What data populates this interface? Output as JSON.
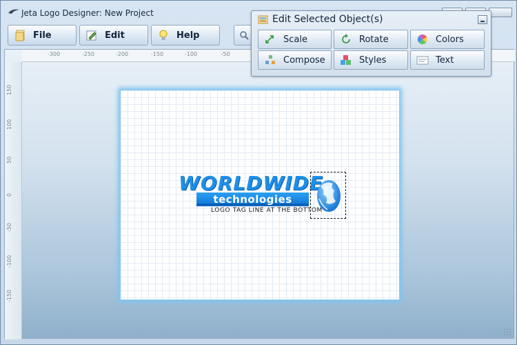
{
  "window": {
    "title": "Jeta Logo Designer: New Project"
  },
  "toolbar": {
    "file_label": "File",
    "edit_label": "Edit",
    "help_label": "Help"
  },
  "ruler": {
    "top_ticks": [
      "-300",
      "-250",
      "-200",
      "-150",
      "-100",
      "-50"
    ],
    "left_ticks": [
      "150",
      "100",
      "50",
      "0",
      "-50",
      "-100",
      "-150"
    ]
  },
  "logo": {
    "main_text": "WORLDWIDE",
    "sub_text": "technologies",
    "tagline": "LOGO TAG LINE AT THE BOTTOM"
  },
  "dialog": {
    "title": "Edit Selected Object(s)",
    "buttons": {
      "scale": "Scale",
      "rotate": "Rotate",
      "colors": "Colors",
      "compose": "Compose",
      "styles": "Styles",
      "text": "Text"
    }
  },
  "colors": {
    "accent": "#1e8fe8",
    "canvas_glow": "#7fc4ef"
  },
  "icons": {
    "file": "file-icon",
    "edit": "edit-icon",
    "help": "lightbulb-icon",
    "scale": "scale-icon",
    "rotate": "rotate-icon",
    "colors": "color-wheel-icon",
    "compose": "compose-icon",
    "styles": "styles-icon",
    "text": "text-icon"
  }
}
